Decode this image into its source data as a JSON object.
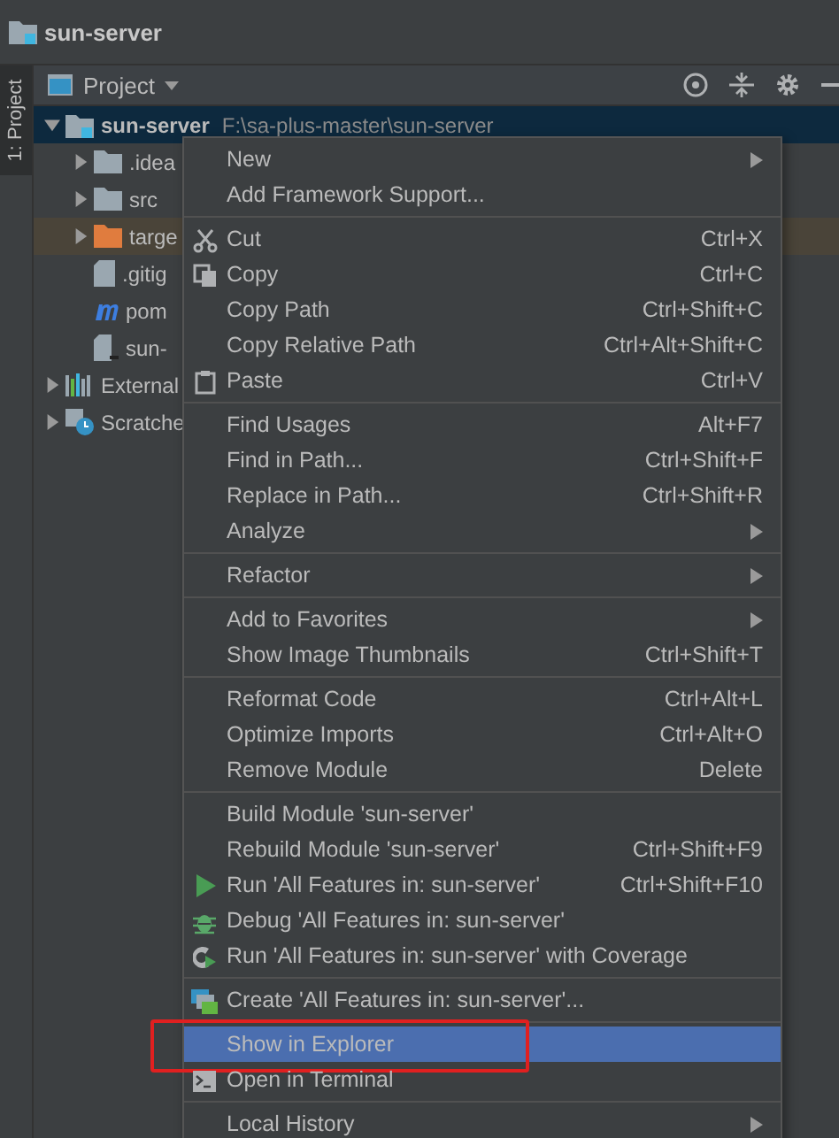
{
  "breadcrumb": {
    "label": "sun-server"
  },
  "side_tab": {
    "label": "1: Project",
    "selected": true
  },
  "panel": {
    "title": "Project"
  },
  "tree": [
    {
      "kind": "module",
      "label": "sun-server",
      "path": "F:\\sa-plus-master\\sun-server",
      "expanded": true,
      "selected": true,
      "highlighted": false,
      "children": [
        {
          "kind": "folder",
          "label": ".idea",
          "expanded": false,
          "selected": false,
          "highlighted": false
        },
        {
          "kind": "folder",
          "label": "src",
          "expanded": false,
          "selected": false,
          "highlighted": false
        },
        {
          "kind": "excluded-folder",
          "label": "targe",
          "expanded": false,
          "selected": false,
          "highlighted": true
        },
        {
          "kind": "file",
          "label": ".gitig",
          "selected": false,
          "highlighted": false
        },
        {
          "kind": "maven",
          "label": "pom",
          "selected": false,
          "highlighted": false
        },
        {
          "kind": "iml",
          "label": "sun-",
          "selected": false,
          "highlighted": false
        }
      ]
    },
    {
      "kind": "library",
      "label": "External",
      "expanded": false,
      "selected": false,
      "highlighted": false
    },
    {
      "kind": "scratch",
      "label": "Scratche",
      "expanded": false,
      "selected": false,
      "highlighted": false
    }
  ],
  "menu": {
    "groups": [
      [
        {
          "label": "New",
          "submenu": true,
          "selected": false,
          "marked": false
        },
        {
          "label": "Add Framework Support...",
          "submenu": false,
          "selected": false,
          "marked": false
        }
      ],
      [
        {
          "label": "Cut",
          "shortcut": "Ctrl+X",
          "submenu": false,
          "selected": false,
          "marked": false
        },
        {
          "label": "Copy",
          "shortcut": "Ctrl+C",
          "submenu": false,
          "selected": false,
          "marked": false
        },
        {
          "label": "Copy Path",
          "shortcut": "Ctrl+Shift+C",
          "submenu": false,
          "selected": false,
          "marked": false
        },
        {
          "label": "Copy Relative Path",
          "shortcut": "Ctrl+Alt+Shift+C",
          "submenu": false,
          "selected": false,
          "marked": false
        },
        {
          "label": "Paste",
          "shortcut": "Ctrl+V",
          "submenu": false,
          "selected": false,
          "marked": false
        }
      ],
      [
        {
          "label": "Find Usages",
          "shortcut": "Alt+F7",
          "submenu": false,
          "selected": false,
          "marked": false
        },
        {
          "label": "Find in Path...",
          "shortcut": "Ctrl+Shift+F",
          "submenu": false,
          "selected": false,
          "marked": false
        },
        {
          "label": "Replace in Path...",
          "shortcut": "Ctrl+Shift+R",
          "submenu": false,
          "selected": false,
          "marked": false
        },
        {
          "label": "Analyze",
          "submenu": true,
          "selected": false,
          "marked": false
        }
      ],
      [
        {
          "label": "Refactor",
          "submenu": true,
          "selected": false,
          "marked": false
        }
      ],
      [
        {
          "label": "Add to Favorites",
          "submenu": true,
          "selected": false,
          "marked": false
        },
        {
          "label": "Show Image Thumbnails",
          "shortcut": "Ctrl+Shift+T",
          "submenu": false,
          "selected": false,
          "marked": false
        }
      ],
      [
        {
          "label": "Reformat Code",
          "shortcut": "Ctrl+Alt+L",
          "submenu": false,
          "selected": false,
          "marked": false
        },
        {
          "label": "Optimize Imports",
          "shortcut": "Ctrl+Alt+O",
          "submenu": false,
          "selected": false,
          "marked": false
        },
        {
          "label": "Remove Module",
          "shortcut": "Delete",
          "submenu": false,
          "selected": false,
          "marked": false
        }
      ],
      [
        {
          "label": "Build Module 'sun-server'",
          "submenu": false,
          "selected": false,
          "marked": false
        },
        {
          "label": "Rebuild Module 'sun-server'",
          "shortcut": "Ctrl+Shift+F9",
          "submenu": false,
          "selected": false,
          "marked": false
        },
        {
          "label": "Run 'All Features in: sun-server'",
          "shortcut": "Ctrl+Shift+F10",
          "submenu": false,
          "selected": false,
          "marked": false
        },
        {
          "label": "Debug 'All Features in: sun-server'",
          "submenu": false,
          "selected": false,
          "marked": false
        },
        {
          "label": "Run 'All Features in: sun-server' with Coverage",
          "submenu": false,
          "selected": false,
          "marked": false
        }
      ],
      [
        {
          "label": "Create 'All Features in: sun-server'...",
          "submenu": false,
          "selected": false,
          "marked": false
        }
      ],
      [
        {
          "label": "Show in Explorer",
          "submenu": false,
          "selected": true,
          "marked": true
        },
        {
          "label": "Open in Terminal",
          "submenu": false,
          "selected": false,
          "marked": false
        }
      ],
      [
        {
          "label": "Local History",
          "submenu": true,
          "selected": false,
          "marked": false
        }
      ]
    ]
  }
}
